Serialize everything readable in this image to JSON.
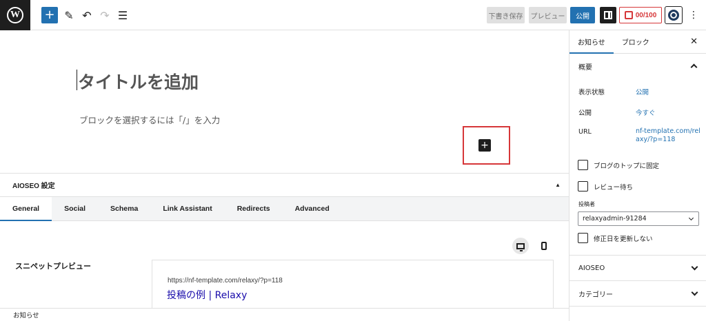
{
  "toolbar": {
    "save_draft": "下書き保存",
    "preview": "プレビュー",
    "publish": "公開",
    "seo_score": "00/100",
    "accent": "#2271b1",
    "score_color": "#d63638"
  },
  "editor": {
    "title_placeholder": "タイトルを追加",
    "block_placeholder": "ブロックを選択するには「/」を入力"
  },
  "aioseo": {
    "heading": "AIOSEO 設定",
    "tabs": [
      "General",
      "Social",
      "Schema",
      "Link Assistant",
      "Redirects",
      "Advanced"
    ],
    "active_tab": "General",
    "snippet_label": "スニペットプレビュー",
    "snippet_url": "https://nf-template.com/relaxy/?p=118",
    "snippet_title": "投稿の例 | Relaxy"
  },
  "status_bar": {
    "breadcrumb": "お知らせ"
  },
  "sidebar": {
    "tabs": [
      "お知らせ",
      "ブロック"
    ],
    "summary": {
      "title": "概要",
      "visibility_label": "表示状態",
      "visibility_value": "公開",
      "publish_label": "公開",
      "publish_value": "今すぐ",
      "url_label": "URL",
      "url_value": "nf-template.com/relaxy/?p=118",
      "stick_label": "ブログのトップに固定",
      "pending_label": "レビュー待ち",
      "author_label": "投稿者",
      "author_value": "relaxyadmin-91284",
      "no_update_label": "修正日を更新しない"
    },
    "panels": [
      "AIOSEO",
      "カテゴリー"
    ]
  }
}
